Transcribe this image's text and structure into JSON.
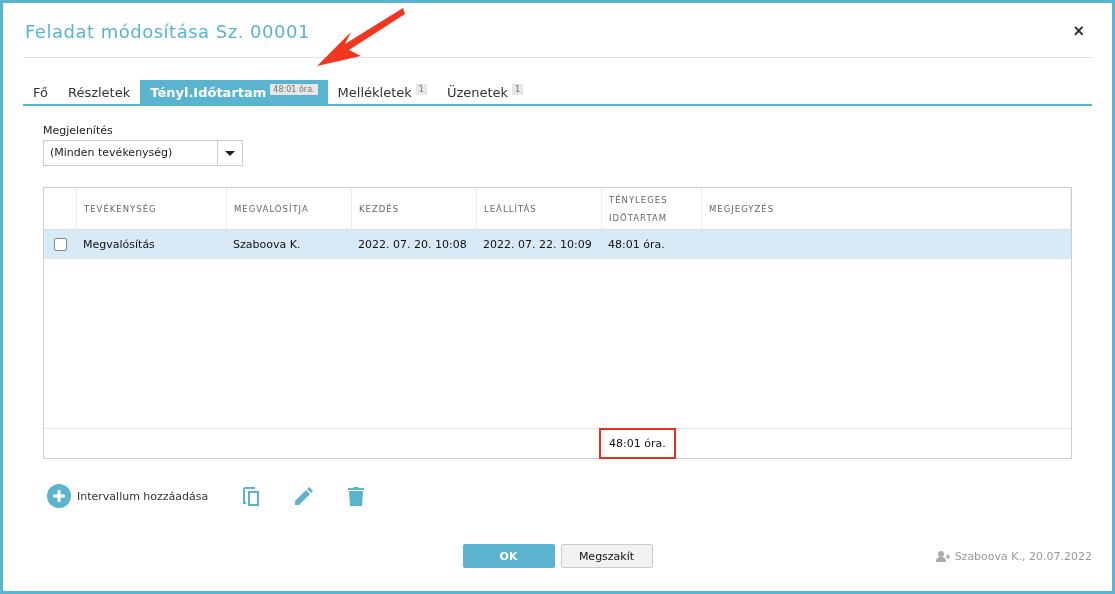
{
  "window": {
    "title": "Feladat módosítása Sz. 00001",
    "close": "×"
  },
  "tabs": [
    {
      "label": "Fő",
      "selected": false
    },
    {
      "label": "Részletek",
      "selected": false
    },
    {
      "label": "Tényl.Időtartam",
      "selected": true,
      "badge": "48:01 óra."
    },
    {
      "label": "Mellékletek",
      "selected": false,
      "badge": "1"
    },
    {
      "label": "Üzenetek",
      "selected": false,
      "badge": "1"
    }
  ],
  "filter": {
    "label": "Megjelenítés",
    "value": "(Minden tevékenység)"
  },
  "table": {
    "columns": [
      "TEVÉKENYSÉG",
      "MEGVALÓSÍTJA",
      "KEZDÉS",
      "LEÁLLÍTÁS",
      "TÉNYLEGES IDŐTARTAM",
      "MEGJEGYZÉS"
    ],
    "rows": [
      {
        "selected": true,
        "checked": false,
        "cells": [
          "Megvalósítás",
          "Szaboova K.",
          "2022. 07. 20. 10:08",
          "2022. 07. 22. 10:09",
          "48:01 óra.",
          ""
        ]
      }
    ],
    "total": "48:01 óra.",
    "total_highlighted": true
  },
  "actions": {
    "add": "Intervallum hozzáadása"
  },
  "buttons": [
    {
      "label": "OK",
      "kind": "primary"
    },
    {
      "label": "Megszakít",
      "kind": "secondary"
    }
  ],
  "footer": "Szaboova K., 20.07.2022"
}
